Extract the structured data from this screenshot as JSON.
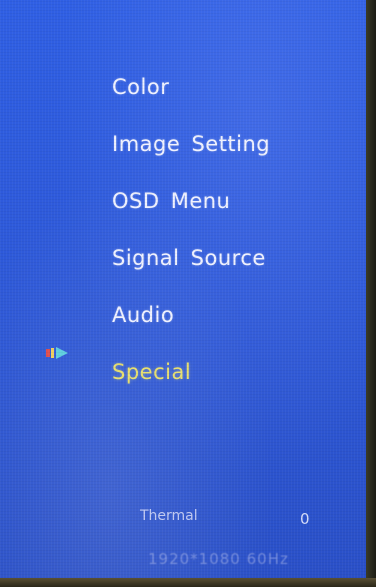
{
  "osd": {
    "menu_items": [
      {
        "label": "Color",
        "selected": false
      },
      {
        "label": "Image Setting",
        "selected": false
      },
      {
        "label": "OSD Menu",
        "selected": false
      },
      {
        "label": "Signal Source",
        "selected": false
      },
      {
        "label": "Audio",
        "selected": false
      },
      {
        "label": "Special",
        "selected": true
      }
    ],
    "pointer_icon": "selection-pointer-icon",
    "status": {
      "thermal_label": "Thermal",
      "thermal_value": "0",
      "resolution": "1920*1080 60Hz"
    }
  },
  "colors": {
    "background": "#2d58d8",
    "menu_text": "#f0f2ff",
    "selected_text": "#e8e070"
  }
}
